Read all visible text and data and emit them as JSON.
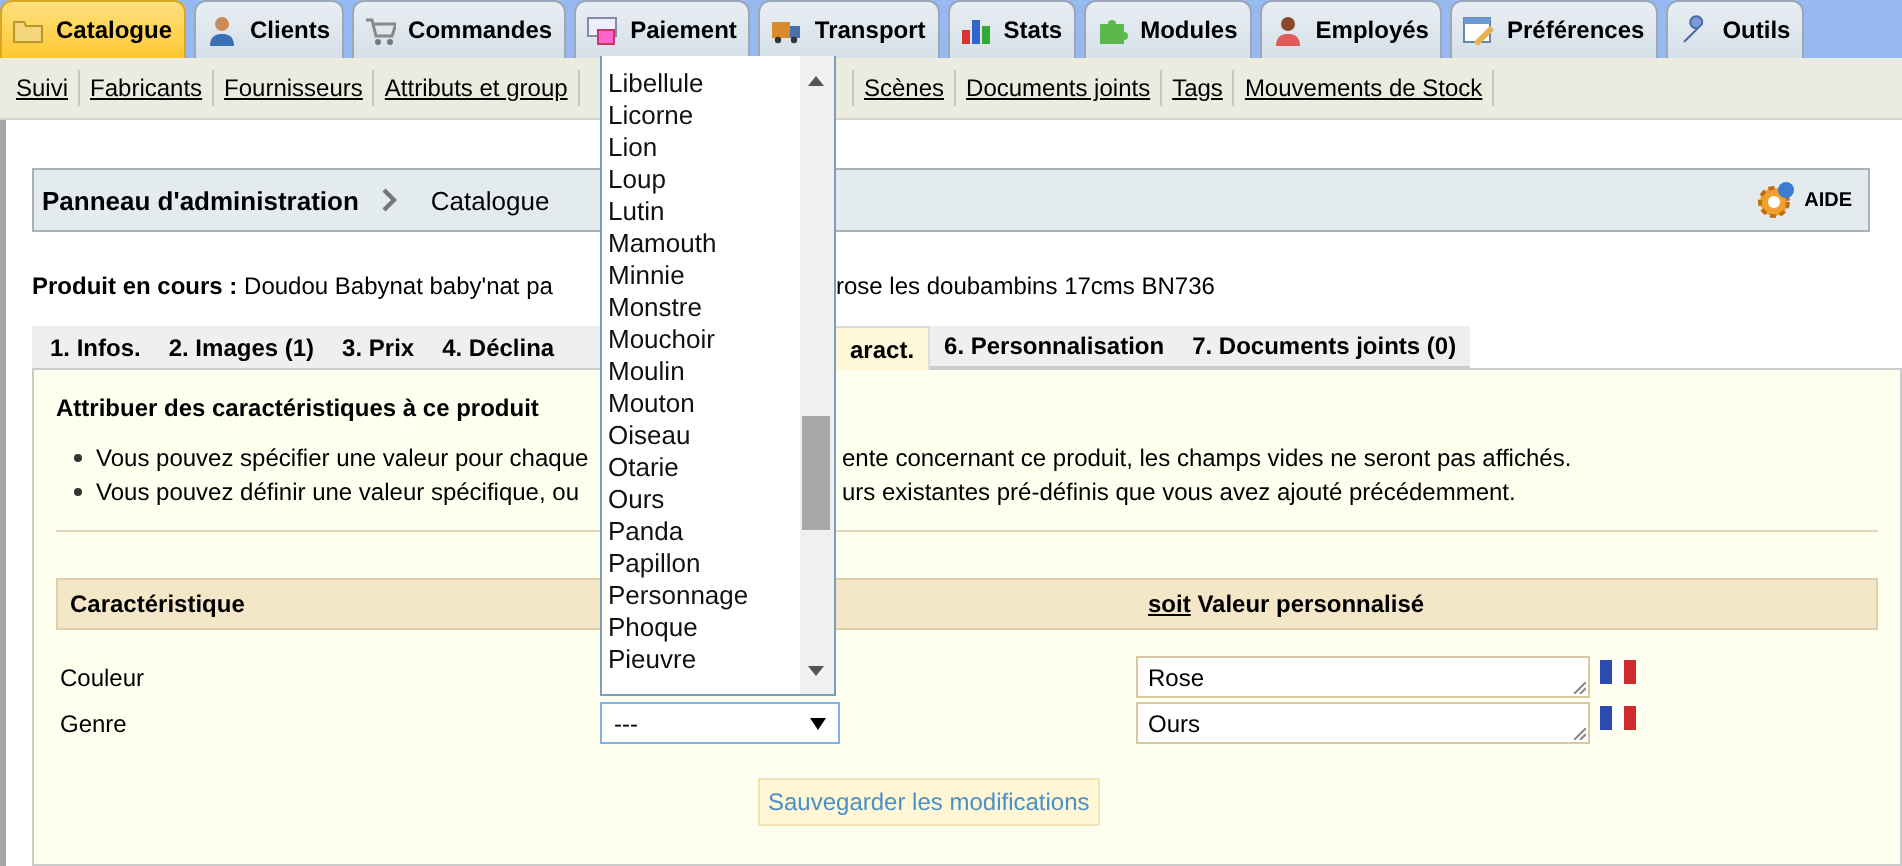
{
  "main_tabs": [
    {
      "label": "Catalogue",
      "selected": true
    },
    {
      "label": "Clients",
      "selected": false
    },
    {
      "label": "Commandes",
      "selected": false
    },
    {
      "label": "Paiement",
      "selected": false
    },
    {
      "label": "Transport",
      "selected": false
    },
    {
      "label": "Stats",
      "selected": false
    },
    {
      "label": "Modules",
      "selected": false
    },
    {
      "label": "Employés",
      "selected": false
    },
    {
      "label": "Préférences",
      "selected": false
    },
    {
      "label": "Outils",
      "selected": false
    }
  ],
  "sub_nav": {
    "left": [
      "Suivi",
      "Fabricants",
      "Fournisseurs",
      "Attributs et group"
    ],
    "right": [
      "Scènes",
      "Documents joints",
      "Tags",
      "Mouvements de Stock"
    ]
  },
  "breadcrumb": {
    "root": "Panneau d'administration",
    "current": "Catalogue"
  },
  "help_button": "AIDE",
  "current_product": {
    "label": "Produit en cours :",
    "name_left": "Doudou Babynat baby'nat pa",
    "name_right": "rose les doubambins 17cms BN736"
  },
  "product_tabs": {
    "left": [
      {
        "label": "1. Infos.",
        "selected": false
      },
      {
        "label": "2. Images (1)",
        "selected": false
      },
      {
        "label": "3. Prix",
        "selected": false
      },
      {
        "label": "4. Déclina",
        "selected": false
      }
    ],
    "right": [
      {
        "label": "aract.",
        "selected": true
      },
      {
        "label": "6. Personnalisation",
        "selected": false
      },
      {
        "label": "7. Documents joints (0)",
        "selected": false
      }
    ]
  },
  "features": {
    "title": "Attribuer des caractéristiques à ce produit",
    "notes": [
      {
        "left": "Vous pouvez spécifier une valeur pour chaque",
        "right": "ente concernant ce produit, les champs vides ne seront pas affichés."
      },
      {
        "left": "Vous pouvez définir une valeur spécifique, ou",
        "right": "urs existantes pré-définis que vous avez ajouté précédemment."
      }
    ],
    "table": {
      "column_1": "Caractéristique",
      "column_3_prefix": "soit",
      "column_3": "Valeur personnalisé",
      "rows": [
        {
          "feature": "Couleur",
          "custom_value": "Rose"
        },
        {
          "feature": "Genre",
          "select_value": "---",
          "custom_value": "Ours"
        }
      ]
    },
    "save_button": "Sauvegarder les modifications"
  },
  "dropdown": {
    "open": true,
    "options": [
      "Libellule",
      "Licorne",
      "Lion",
      "Loup",
      "Lutin",
      "Mamouth",
      "Minnie",
      "Monstre",
      "Mouchoir",
      "Moulin",
      "Mouton",
      "Oiseau",
      "Otarie",
      "Ours",
      "Panda",
      "Papillon",
      "Personnage",
      "Phoque",
      "Pieuvre"
    ]
  }
}
